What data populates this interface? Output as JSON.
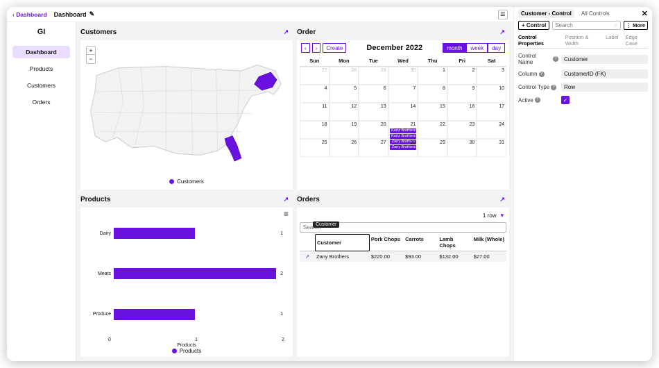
{
  "topbar": {
    "back": "Dashboard",
    "current": "Dashboard"
  },
  "logo": "GI",
  "nav": {
    "items": [
      "Dashboard",
      "Products",
      "Customers",
      "Orders"
    ],
    "activeIndex": 0
  },
  "panels": {
    "customers": {
      "title": "Customers",
      "legend": "Customers"
    },
    "order": {
      "title": "Order",
      "monthTitle": "December 2022",
      "createLabel": "Create",
      "views": [
        "month",
        "week",
        "day"
      ],
      "activeView": 0,
      "dow": [
        "Sun",
        "Mon",
        "Tue",
        "Wed",
        "Thu",
        "Fri",
        "Sat"
      ],
      "weeks": [
        [
          {
            "n": 27,
            "dim": true
          },
          {
            "n": 28,
            "dim": true
          },
          {
            "n": 29,
            "dim": true
          },
          {
            "n": 30,
            "dim": true
          },
          {
            "n": 1
          },
          {
            "n": 2
          },
          {
            "n": 3
          }
        ],
        [
          {
            "n": 4
          },
          {
            "n": 5
          },
          {
            "n": 6
          },
          {
            "n": 7
          },
          {
            "n": 8
          },
          {
            "n": 9
          },
          {
            "n": 10
          }
        ],
        [
          {
            "n": 11
          },
          {
            "n": 12
          },
          {
            "n": 13
          },
          {
            "n": 14
          },
          {
            "n": 15
          },
          {
            "n": 16
          },
          {
            "n": 17
          }
        ],
        [
          {
            "n": 18
          },
          {
            "n": 19
          },
          {
            "n": 20
          },
          {
            "n": 21,
            "events": [
              "Kurtz Brothers",
              "Kurtz Brothers",
              "Zany Brothers",
              "Zany Brothers"
            ]
          },
          {
            "n": 22
          },
          {
            "n": 23
          },
          {
            "n": 24
          }
        ],
        [
          {
            "n": 25
          },
          {
            "n": 26
          },
          {
            "n": 27
          },
          {
            "n": 28
          },
          {
            "n": 29
          },
          {
            "n": 30
          },
          {
            "n": 31
          }
        ]
      ]
    },
    "products": {
      "title": "Products",
      "axisLabel": "Products",
      "legend": "Products"
    },
    "orders": {
      "title": "Orders",
      "rowCount": "1 row",
      "searchPlaceholder": "Search",
      "tooltip": "Customer",
      "columns": [
        "",
        "Customer",
        "Pork Chops",
        "Carrots",
        "Lamb Chops",
        "Milk (Whole)"
      ],
      "row": {
        "customer": "Zany Brothers",
        "c1": "$220.00",
        "c2": "$93.00",
        "c3": "$132.00",
        "c4": "$27.00"
      }
    }
  },
  "chart_data": {
    "type": "bar",
    "orientation": "horizontal",
    "categories": [
      "Dairy",
      "Meats",
      "Produce"
    ],
    "values": [
      1,
      2,
      1
    ],
    "title": "Products",
    "xlabel": "Products",
    "ylabel": "",
    "xlim": [
      0,
      2
    ],
    "ticks": [
      0,
      1,
      2
    ],
    "series_color": "#6912e0"
  },
  "inspector": {
    "tabs": [
      "Customer - Control",
      "All Controls"
    ],
    "activeTab": 0,
    "addControl": "+ Control",
    "searchPlaceholder": "Search",
    "more": "More",
    "subtabs": [
      "Control Properties",
      "Position & Width",
      "Label",
      "Edge Case"
    ],
    "activeSub": 0,
    "props": {
      "controlNameLabel": "Control Name",
      "controlName": "Customer",
      "columnLabel": "Column",
      "column": "CustomerID (FK)",
      "controlTypeLabel": "Control Type",
      "controlType": "Row",
      "activeLabel": "Active",
      "active": true
    }
  }
}
